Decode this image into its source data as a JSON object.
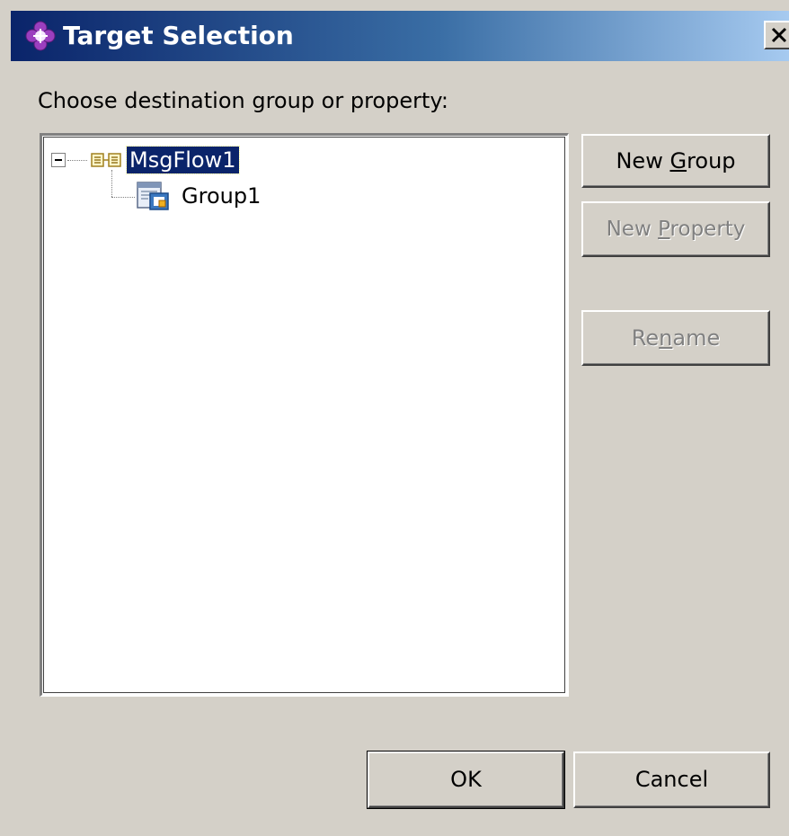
{
  "window": {
    "title": "Target Selection",
    "icon": "purple-flower-icon",
    "close_icon": "close-x-icon"
  },
  "prompt": {
    "label": "Choose destination group or property:"
  },
  "tree": {
    "nodes": [
      {
        "label": "MsgFlow1",
        "icon": "message-flow-icon",
        "expanded": true,
        "selected": true,
        "children": [
          {
            "label": "Group1",
            "icon": "group-icon",
            "selected": false
          }
        ]
      }
    ]
  },
  "buttons": {
    "new_group": {
      "label_pre": "New ",
      "label_mnemonic": "G",
      "label_post": "roup",
      "enabled": true
    },
    "new_property": {
      "label_pre": "New ",
      "label_mnemonic": "P",
      "label_post": "roperty",
      "enabled": false
    },
    "rename": {
      "label_pre": "Re",
      "label_mnemonic": "n",
      "label_post": "ame",
      "enabled": false
    },
    "ok": {
      "label": "OK",
      "enabled": true,
      "default": true
    },
    "cancel": {
      "label": "Cancel",
      "enabled": true
    }
  },
  "colors": {
    "title_bar_start": "#0a246a",
    "title_bar_end": "#a6caf0",
    "dialog_background": "#d4d0c8",
    "selection_background": "#0a246a",
    "icon_purple": "#8b2ca8"
  }
}
